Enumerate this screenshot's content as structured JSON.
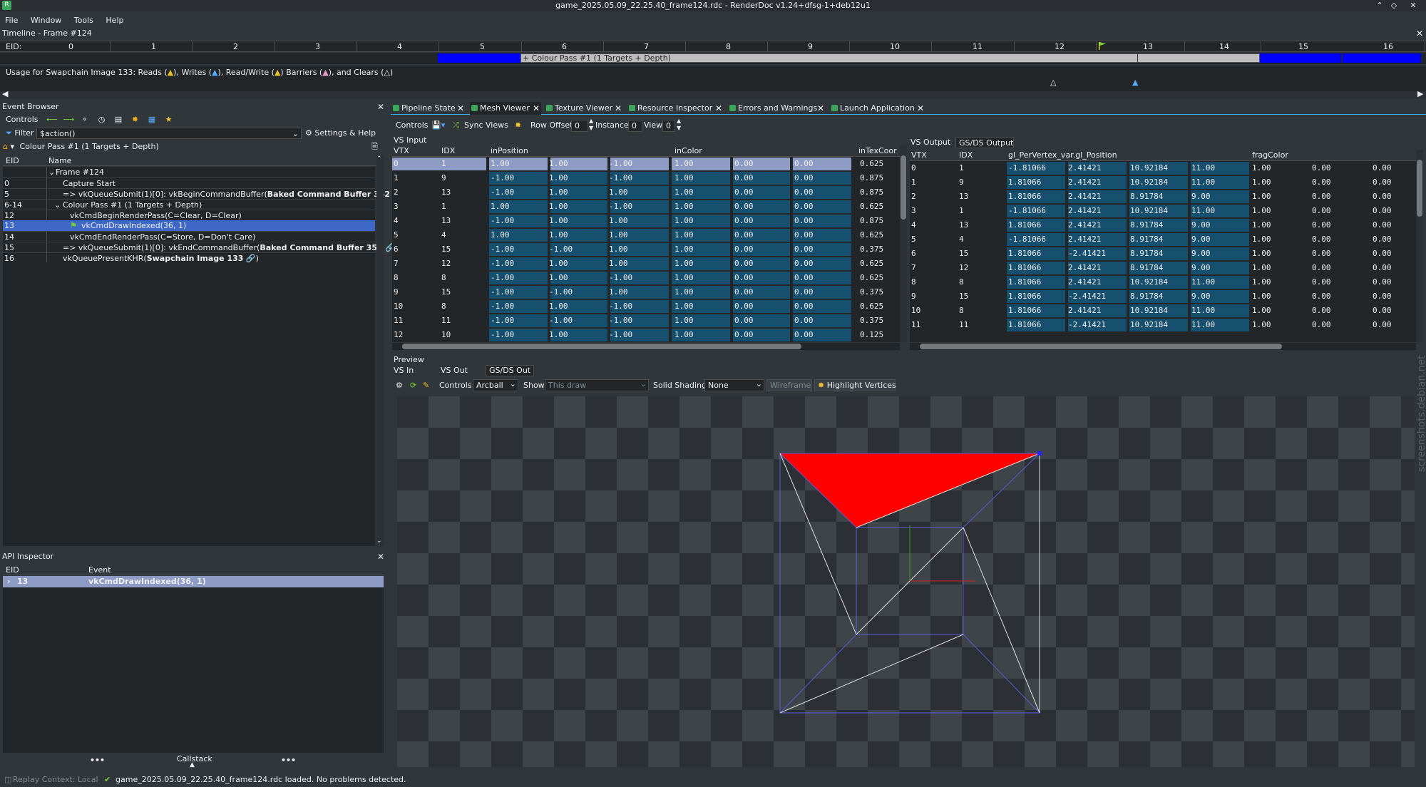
{
  "window": {
    "title": "game_2025.05.09_22.25.40_frame124.rdc - RenderDoc v1.24+dfsg-1+deb12u1"
  },
  "menu": [
    "File",
    "Window",
    "Tools",
    "Help"
  ],
  "timeline": {
    "title": "Timeline - Frame #124",
    "eid_label": "EID:",
    "ticks": [
      "0",
      "1",
      "2",
      "3",
      "4",
      "5",
      "6",
      "7",
      "8",
      "9",
      "10",
      "11",
      "12",
      "13",
      "14",
      "16"
    ],
    "tick15": "15",
    "pass_label": "+ Colour Pass #1 (1 Targets + Depth)",
    "usage": {
      "prefix": "Usage for Swapchain Image 133: Reads (",
      "writes": "), Writes (",
      "rw": "), Read/Write (",
      "barriers": ") Barriers (",
      "clears": "), and Clears (",
      "end": ")"
    }
  },
  "event_browser": {
    "title": "Event Browser",
    "controls_label": "Controls",
    "filter_label": "Filter",
    "filter_value": "$action()",
    "settings_label": "Settings & Help",
    "breadcrumb": "Colour Pass #1 (1 Targets + Depth)",
    "col_eid": "EID",
    "col_name": "Name",
    "rows": [
      {
        "eid": "",
        "name": "Frame #124"
      },
      {
        "eid": "0",
        "name": "Capture Start"
      },
      {
        "eid": "5",
        "name": "=> vkQueueSubmit(1)[0]: vkBeginCommandBuffer(",
        "bold": "Baked Command Buffer 352"
      },
      {
        "eid": "6-14",
        "name": "Colour Pass #1 (1 Targets + Depth)"
      },
      {
        "eid": "12",
        "name": "vkCmdBeginRenderPass(C=Clear, D=Clear)"
      },
      {
        "eid": "13",
        "name": "vkCmdDrawIndexed(36, 1)"
      },
      {
        "eid": "14",
        "name": "vkCmdEndRenderPass(C=Store, D=Don't Care)"
      },
      {
        "eid": "15",
        "name": "=> vkQueueSubmit(1)[0]: vkEndCommandBuffer(",
        "bold": "Baked Command Buffer 352"
      },
      {
        "eid": "16",
        "name": "vkQueuePresentKHR(",
        "bold": "Swapchain Image 133"
      }
    ]
  },
  "api_inspector": {
    "title": "API Inspector",
    "col_eid": "EID",
    "col_event": "Event",
    "row_eid": "13",
    "row_event": "vkCmdDrawIndexed(36, 1)",
    "callstack": "Callstack"
  },
  "tabs": [
    "Pipeline State",
    "Mesh Viewer",
    "Texture Viewer",
    "Resource Inspector",
    "Errors and Warnings",
    "Launch Application"
  ],
  "mesh": {
    "controls_label": "Controls",
    "sync_views": "Sync Views",
    "row_offset_label": "Row Offset",
    "row_offset": "0",
    "instance_label": "Instance",
    "instance": "0",
    "view_label": "View",
    "view": "0",
    "vs_input": {
      "title": "VS Input",
      "cols": [
        "VTX",
        "IDX",
        "inPosition",
        "inColor",
        "inTexCoor"
      ],
      "rows": [
        [
          "0",
          "1",
          "1.00",
          "1.00",
          "-1.00",
          "1.00",
          "0.00",
          "0.00",
          "0.625"
        ],
        [
          "1",
          "9",
          "-1.00",
          "1.00",
          "-1.00",
          "1.00",
          "0.00",
          "0.00",
          "0.875"
        ],
        [
          "2",
          "13",
          "-1.00",
          "1.00",
          "1.00",
          "1.00",
          "0.00",
          "0.00",
          "0.875"
        ],
        [
          "3",
          "1",
          "1.00",
          "1.00",
          "-1.00",
          "1.00",
          "0.00",
          "0.00",
          "0.625"
        ],
        [
          "4",
          "13",
          "-1.00",
          "1.00",
          "1.00",
          "1.00",
          "0.00",
          "0.00",
          "0.875"
        ],
        [
          "5",
          "4",
          "1.00",
          "1.00",
          "1.00",
          "1.00",
          "0.00",
          "0.00",
          "0.625"
        ],
        [
          "6",
          "15",
          "-1.00",
          "-1.00",
          "1.00",
          "1.00",
          "0.00",
          "0.00",
          "0.375"
        ],
        [
          "7",
          "12",
          "-1.00",
          "1.00",
          "1.00",
          "1.00",
          "0.00",
          "0.00",
          "0.625"
        ],
        [
          "8",
          "8",
          "-1.00",
          "1.00",
          "-1.00",
          "1.00",
          "0.00",
          "0.00",
          "0.625"
        ],
        [
          "9",
          "15",
          "-1.00",
          "-1.00",
          "1.00",
          "1.00",
          "0.00",
          "0.00",
          "0.375"
        ],
        [
          "10",
          "8",
          "-1.00",
          "1.00",
          "-1.00",
          "1.00",
          "0.00",
          "0.00",
          "0.625"
        ],
        [
          "11",
          "11",
          "-1.00",
          "-1.00",
          "-1.00",
          "1.00",
          "0.00",
          "0.00",
          "0.375"
        ],
        [
          "12",
          "10",
          "-1.00",
          "1.00",
          "-1.00",
          "1.00",
          "0.00",
          "0.00",
          "0.125"
        ]
      ]
    },
    "vs_output": {
      "tab1": "VS Output",
      "tab2": "GS/DS Output",
      "cols": [
        "VTX",
        "IDX",
        "gl_PerVertex_var.gl_Position",
        "fragColor"
      ],
      "rows": [
        [
          "0",
          "1",
          "-1.81066",
          "2.41421",
          "10.92184",
          "11.00",
          "1.00",
          "0.00",
          "0.00"
        ],
        [
          "1",
          "9",
          "1.81066",
          "2.41421",
          "10.92184",
          "11.00",
          "1.00",
          "0.00",
          "0.00"
        ],
        [
          "2",
          "13",
          "1.81066",
          "2.41421",
          "8.91784",
          "9.00",
          "1.00",
          "0.00",
          "0.00"
        ],
        [
          "3",
          "1",
          "-1.81066",
          "2.41421",
          "10.92184",
          "11.00",
          "1.00",
          "0.00",
          "0.00"
        ],
        [
          "4",
          "13",
          "1.81066",
          "2.41421",
          "8.91784",
          "9.00",
          "1.00",
          "0.00",
          "0.00"
        ],
        [
          "5",
          "4",
          "-1.81066",
          "2.41421",
          "8.91784",
          "9.00",
          "1.00",
          "0.00",
          "0.00"
        ],
        [
          "6",
          "15",
          "1.81066",
          "-2.41421",
          "8.91784",
          "9.00",
          "1.00",
          "0.00",
          "0.00"
        ],
        [
          "7",
          "12",
          "1.81066",
          "2.41421",
          "8.91784",
          "9.00",
          "1.00",
          "0.00",
          "0.00"
        ],
        [
          "8",
          "8",
          "1.81066",
          "2.41421",
          "10.92184",
          "11.00",
          "1.00",
          "0.00",
          "0.00"
        ],
        [
          "9",
          "15",
          "1.81066",
          "-2.41421",
          "8.91784",
          "9.00",
          "1.00",
          "0.00",
          "0.00"
        ],
        [
          "10",
          "8",
          "1.81066",
          "2.41421",
          "10.92184",
          "11.00",
          "1.00",
          "0.00",
          "0.00"
        ],
        [
          "11",
          "11",
          "1.81066",
          "-2.41421",
          "10.92184",
          "11.00",
          "1.00",
          "0.00",
          "0.00"
        ]
      ]
    },
    "preview": {
      "title": "Preview",
      "tabs": [
        "VS In",
        "VS Out",
        "GS/DS Out"
      ],
      "controls_label": "Controls",
      "controls_value": "Arcball",
      "show_label": "Show",
      "show_value": "This draw",
      "shading_label": "Solid Shading",
      "shading_value": "None",
      "wireframe": "Wireframe",
      "highlight": "Highlight Vertices"
    }
  },
  "status": {
    "replay": "Replay Context: Local",
    "message": "game_2025.05.09_22.25.40_frame124.rdc loaded. No problems detected."
  },
  "watermark": "screenshots.debian.net",
  "colors": {
    "accent": "#3daee9",
    "selection": "#3e68c8",
    "highlight_cell": "#17506e",
    "pass_blue": "#0000ff",
    "triangle": "#ff0000"
  }
}
